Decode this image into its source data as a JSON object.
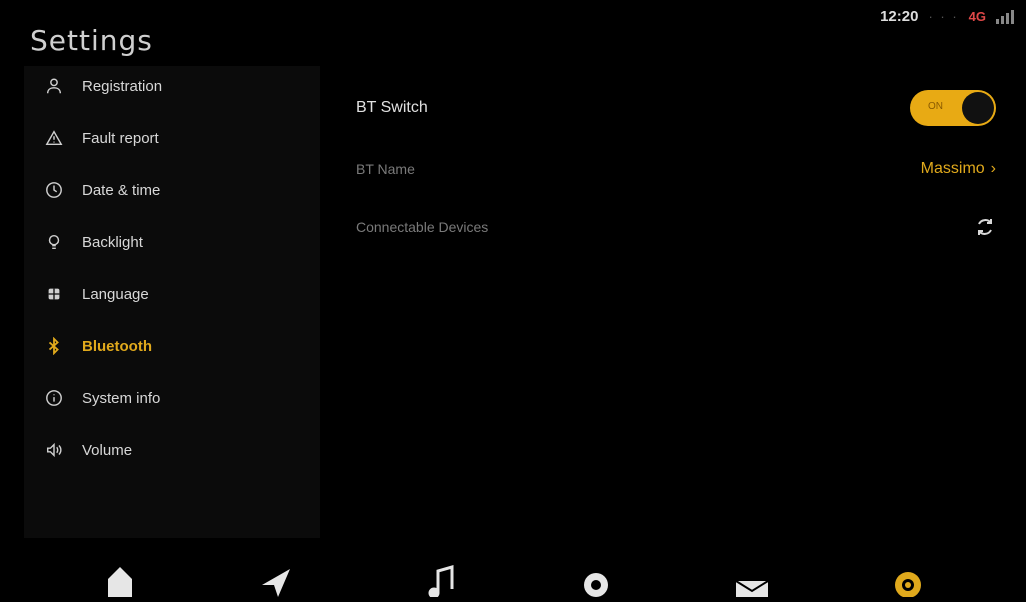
{
  "header": {
    "title": "Settings"
  },
  "status_bar": {
    "time": "12:20",
    "network": "4G"
  },
  "sidebar": {
    "items": [
      {
        "label": "Registration",
        "icon": "person-icon"
      },
      {
        "label": "Fault report",
        "icon": "warning-icon"
      },
      {
        "label": "Date & time",
        "icon": "clock-icon"
      },
      {
        "label": "Backlight",
        "icon": "lightbulb-icon"
      },
      {
        "label": "Language",
        "icon": "globe-icon"
      },
      {
        "label": "Bluetooth",
        "icon": "bluetooth-icon",
        "active": true
      },
      {
        "label": "System info",
        "icon": "info-icon"
      },
      {
        "label": "Volume",
        "icon": "speaker-icon"
      }
    ]
  },
  "main": {
    "bt_switch": {
      "label": "BT Switch",
      "state": "ON"
    },
    "bt_name": {
      "label": "BT Name",
      "value": "Massimo"
    },
    "connectable_devices": {
      "label": "Connectable Devices"
    }
  },
  "bottom_nav": [
    {
      "name": "home-car-icon"
    },
    {
      "name": "navigation-icon"
    },
    {
      "name": "music-icon"
    },
    {
      "name": "camera-icon"
    },
    {
      "name": "message-icon"
    },
    {
      "name": "settings-gear-icon",
      "active": true
    }
  ],
  "colors": {
    "accent": "#e0a91c",
    "background": "#000000",
    "sidebar": "#0b0b0b"
  }
}
